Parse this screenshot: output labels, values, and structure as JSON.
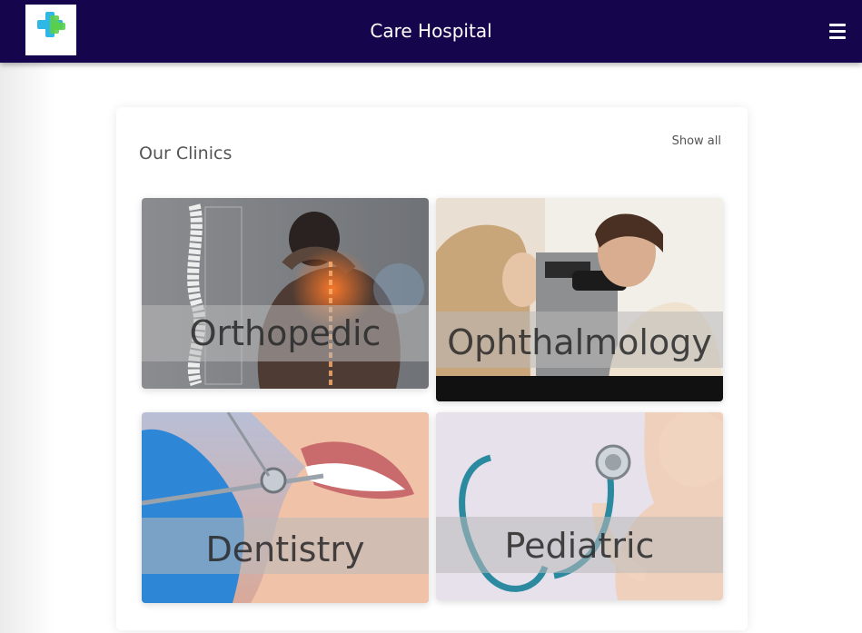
{
  "navbar": {
    "title": "Care Hospital",
    "logo_icon": "medical-cross-logo-icon",
    "logo_colors": [
      "#2fb8e6",
      "#5bcf4a"
    ],
    "menu_icon": "hamburger-menu-icon",
    "background": "#15054d"
  },
  "clinics": {
    "heading": "Our Clinics",
    "show_all_label": "Show all",
    "items": [
      {
        "label": "Orthopedic",
        "image": "spine-neck-pain-photo"
      },
      {
        "label": "Ophthalmology",
        "image": "eye-exam-photo"
      },
      {
        "label": "Dentistry",
        "image": "dental-checkup-photo"
      },
      {
        "label": "Pediatric",
        "image": "baby-stethoscope-photo"
      }
    ]
  }
}
